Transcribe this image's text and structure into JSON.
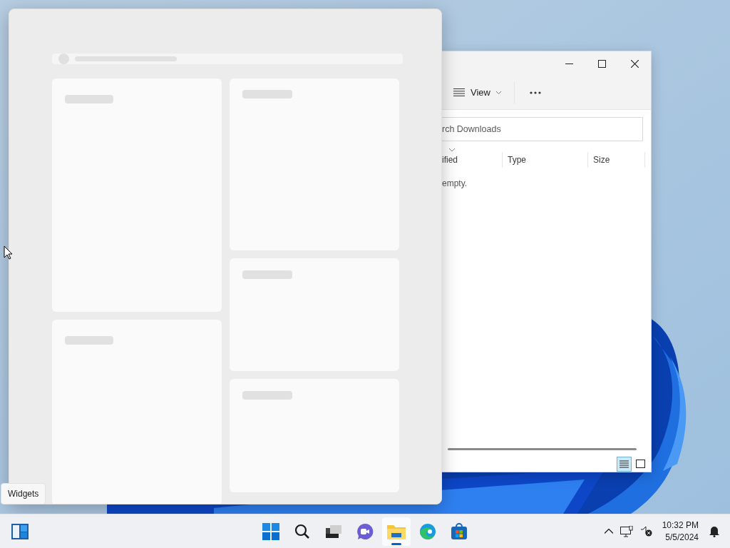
{
  "explorer": {
    "toolbar": {
      "view_label": "View"
    },
    "search": {
      "placeholder": "rch Downloads"
    },
    "columns": [
      "ified",
      "Type",
      "Size"
    ],
    "empty_message": "empty.",
    "view_buttons": [
      {
        "kind": "details",
        "selected": true
      },
      {
        "kind": "tiles",
        "selected": false
      }
    ]
  },
  "tooltip": "Widgets",
  "taskbar": {
    "apps": [
      {
        "kind": "start",
        "selected": false
      },
      {
        "kind": "search",
        "selected": false
      },
      {
        "kind": "taskview",
        "selected": false
      },
      {
        "kind": "chat",
        "selected": false
      },
      {
        "kind": "explorer",
        "selected": true
      },
      {
        "kind": "edge",
        "selected": false
      },
      {
        "kind": "store",
        "selected": false
      }
    ],
    "time": "10:32 PM",
    "date": "5/5/2024"
  }
}
